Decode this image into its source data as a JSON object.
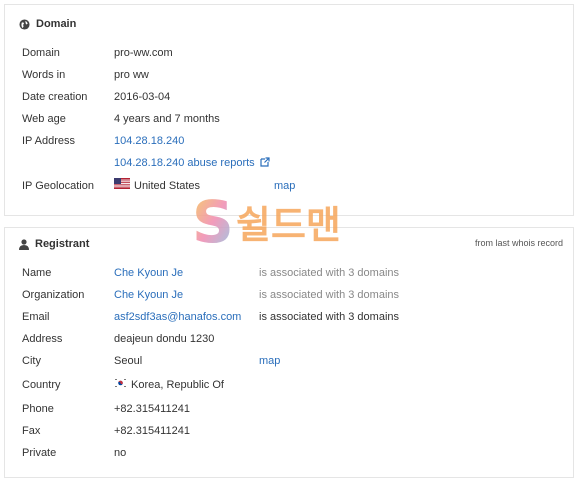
{
  "domain": {
    "title": "Domain",
    "rows": {
      "domain": {
        "label": "Domain",
        "value": "pro-ww.com"
      },
      "words": {
        "label": "Words in",
        "value": "pro ww"
      },
      "date_creation": {
        "label": "Date creation",
        "value": "2016-03-04"
      },
      "web_age": {
        "label": "Web age",
        "value": "4 years and 7 months"
      },
      "ip_address": {
        "label": "IP Address",
        "value": "104.28.18.240",
        "abuse_link": "104.28.18.240 abuse reports"
      },
      "ip_geo": {
        "label": "IP Geolocation",
        "value": "United States",
        "map": "map",
        "flag_icon": "us-flag-icon"
      }
    }
  },
  "registrant": {
    "title": "Registrant",
    "note": "from last whois record",
    "rows": {
      "name": {
        "label": "Name",
        "value": "Che Kyoun Je",
        "assoc": "is associated with 3 domains"
      },
      "organization": {
        "label": "Organization",
        "value": "Che Kyoun Je",
        "assoc": "is associated with 3 domains"
      },
      "email": {
        "label": "Email",
        "value": "asf2sdf3as@hanafos.com",
        "assoc": "is associated with 3 domains"
      },
      "address": {
        "label": "Address",
        "value": "deajeun dondu 1230"
      },
      "city": {
        "label": "City",
        "value": "Seoul",
        "map": "map"
      },
      "country": {
        "label": "Country",
        "value": "Korea, Republic Of",
        "flag_icon": "kr-flag-icon"
      },
      "phone": {
        "label": "Phone",
        "value": "+82.315411241"
      },
      "fax": {
        "label": "Fax",
        "value": "+82.315411241"
      },
      "private": {
        "label": "Private",
        "value": "no"
      }
    }
  },
  "watermark": {
    "letter": "S",
    "text": "쉴드맨"
  },
  "colors": {
    "link": "#2a6ebb",
    "border": "#e5e5e5",
    "muted": "#888888"
  }
}
